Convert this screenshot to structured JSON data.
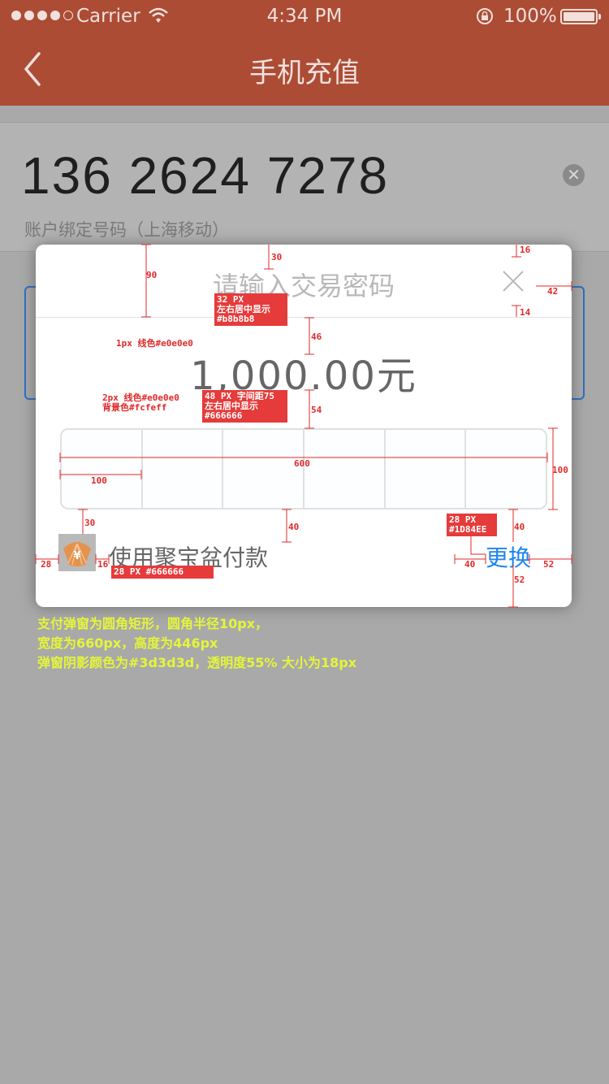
{
  "status_bar": {
    "carrier": "Carrier",
    "time": "4:34 PM",
    "battery": "100%"
  },
  "nav": {
    "title": "手机充值"
  },
  "recharge": {
    "phone_number": "136 2624 7278",
    "hint": "账户绑定号码（上海移动）",
    "clear_icon": "clear-circle-icon"
  },
  "dialog": {
    "title": "请输入交易密码",
    "amount": "1,000.00元",
    "pin_cells": 6,
    "pay_method": "使用聚宝盆付款",
    "change_label": "更换",
    "colors": {
      "title": "#b8b8b8",
      "divider": "#e0e0e0",
      "amount": "#666666",
      "pin_bg": "#fcfeff",
      "change": "#1D84EE",
      "shadow": "#3d3d3d"
    }
  },
  "annotations": {
    "dims": {
      "d90": "90",
      "d30_top": "30",
      "d16": "16",
      "d42": "42",
      "d14": "14",
      "d46": "46",
      "d54": "54",
      "d600": "600",
      "d100_w": "100",
      "d100_h": "100",
      "d30_bottom": "30",
      "d40_left": "40",
      "d40_right": "40",
      "d28": "28",
      "d16_icon": "16",
      "d40_btm": "40",
      "d52_right": "52",
      "d52_bottom": "52"
    },
    "divider_note": "1px 线色#e0e0e0",
    "title_tag": "32 PX\n左右居中显示\n#b8b8b8",
    "amount_tag": "48 PX 字间距75\n左右居中显示\n#666666",
    "pin_note": "2px 线色#e0e0e0\n背景色#fcfeff",
    "pay_tag": "28 PX #666666",
    "change_tag": "28 PX\n#1D84EE",
    "spec_note": [
      "支付弹窗为圆角矩形，圆角半径10px，",
      "宽度为660px，高度为446px",
      "弹窗阴影颜色为#3d3d3d，透明度55% 大小为18px"
    ]
  }
}
